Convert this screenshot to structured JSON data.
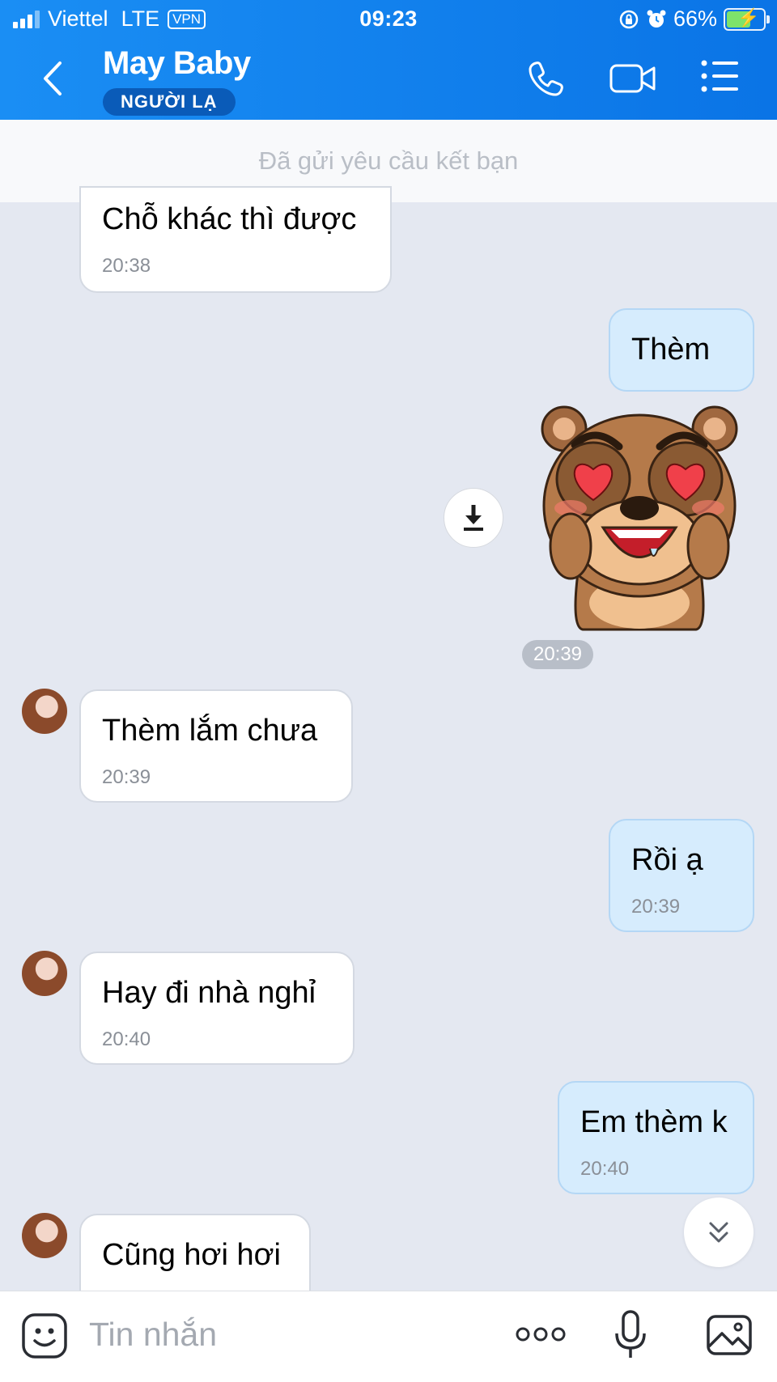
{
  "status_bar": {
    "carrier": "Viettel",
    "network": "LTE",
    "vpn": "VPN",
    "time": "09:23",
    "battery": "66%",
    "battery_level": 0.66
  },
  "header": {
    "title": "May Baby",
    "badge": "NGƯỜI LẠ"
  },
  "banner": "Đã gửi yêu cầu kết bạn",
  "messages": [
    {
      "dir": "in",
      "text": "Chỗ khác thì được",
      "time": "20:38"
    },
    {
      "dir": "out",
      "text": "Thèm"
    },
    {
      "dir": "out",
      "type": "sticker",
      "sticker": "bear-heart-eyes-sticker",
      "time": "20:39"
    },
    {
      "dir": "in",
      "text": "Thèm lắm chưa",
      "time": "20:39"
    },
    {
      "dir": "out",
      "text": "Rồi ạ",
      "time": "20:39"
    },
    {
      "dir": "in",
      "text": "Hay đi nhà nghỉ",
      "time": "20:40"
    },
    {
      "dir": "out",
      "text": "Em thèm k",
      "time": "20:40"
    },
    {
      "dir": "in",
      "text": "Cũng hơi hơi"
    }
  ],
  "composer": {
    "placeholder": "Tin nhắn"
  },
  "colors": {
    "header": "#0a74e6",
    "incoming_bubble": "#ffffff",
    "outgoing_bubble": "#d6ecfd",
    "chat_background": "#e4e8f1"
  }
}
